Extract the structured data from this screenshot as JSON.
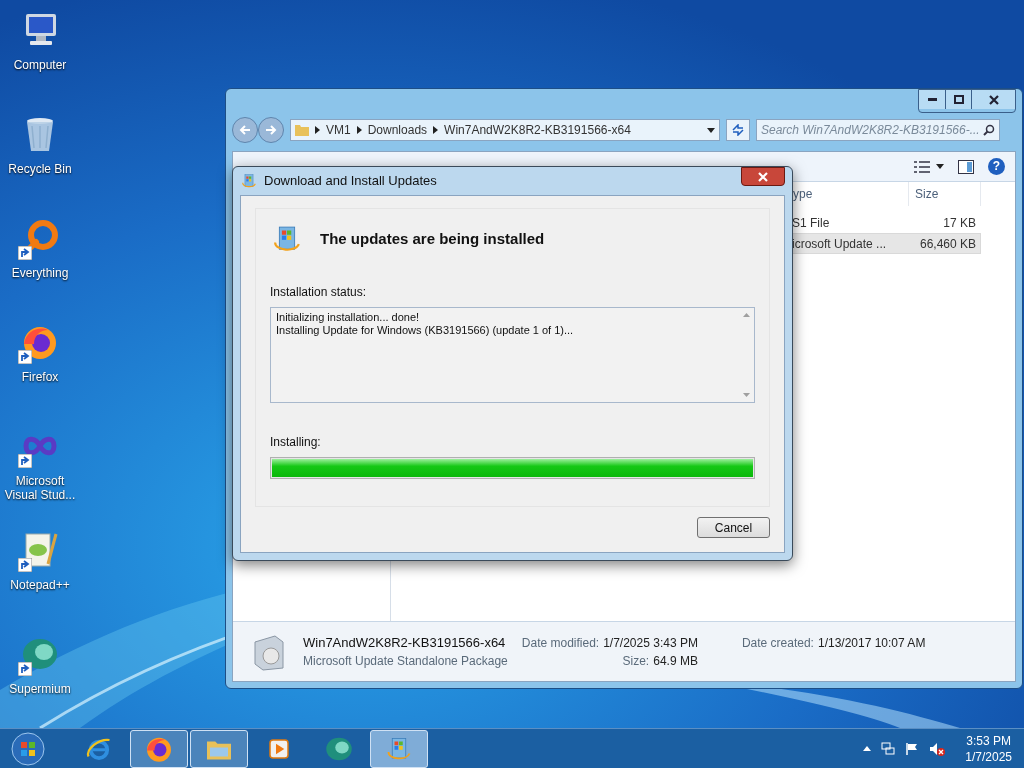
{
  "desktop_icons": [
    {
      "label": "Computer",
      "kind": "computer",
      "shortcut": false
    },
    {
      "label": "Recycle Bin",
      "kind": "bin",
      "shortcut": false
    },
    {
      "label": "Everything",
      "kind": "everything",
      "shortcut": true
    },
    {
      "label": "Firefox",
      "kind": "firefox",
      "shortcut": true
    },
    {
      "label": "Microsoft Visual Stud...",
      "kind": "vs",
      "shortcut": true
    },
    {
      "label": "Notepad++",
      "kind": "notepad",
      "shortcut": true
    },
    {
      "label": "Supermium",
      "kind": "supermium",
      "shortcut": true
    }
  ],
  "explorer": {
    "breadcrumb": [
      "VM1",
      "Downloads",
      "Win7AndW2K8R2-KB3191566-x64"
    ],
    "search": {
      "placeholder": "Search Win7AndW2K8R2-KB3191566-..."
    },
    "help_button": "?",
    "columns": [
      "ype",
      "Size"
    ],
    "rows": [
      {
        "type": "S1 File",
        "size": "17 KB",
        "selected": false
      },
      {
        "type": "icrosoft Update ...",
        "size": "66,460 KB",
        "selected": true
      }
    ],
    "details": {
      "name": "Win7AndW2K8R2-KB3191566-x64",
      "kind_text": "Microsoft Update Standalone Package",
      "fields": [
        {
          "label": "Date modified:",
          "value": "1/7/2025 3:43 PM"
        },
        {
          "label": "Size:",
          "value": "64.9 MB"
        },
        {
          "label": "Date created:",
          "value": "1/13/2017 10:07 AM"
        }
      ]
    }
  },
  "dialog": {
    "title": "Download and Install Updates",
    "heading": "The updates are being installed",
    "status_label": "Installation status:",
    "log": [
      "Initializing installation... done!",
      "Installing Update for Windows (KB3191566) (update 1 of 1)..."
    ],
    "progress_label": "Installing:",
    "progress": {
      "level": 1
    },
    "buttons": [
      "Cancel"
    ]
  },
  "taskbar": {
    "items": [
      {
        "kind": "ie",
        "running": false,
        "selected": false
      },
      {
        "kind": "firefox",
        "running": true,
        "selected": false
      },
      {
        "kind": "folder",
        "running": true,
        "selected": false
      },
      {
        "kind": "media",
        "running": false,
        "selected": false
      },
      {
        "kind": "supermium",
        "running": false,
        "selected": false
      },
      {
        "kind": "update",
        "running": true,
        "selected": true
      }
    ],
    "tray": [
      {
        "kind": "network"
      },
      {
        "kind": "flag"
      },
      {
        "kind": "speaker",
        "muted": true
      }
    ],
    "clock": {
      "time": "3:53 PM",
      "date": "1/7/2025"
    }
  }
}
